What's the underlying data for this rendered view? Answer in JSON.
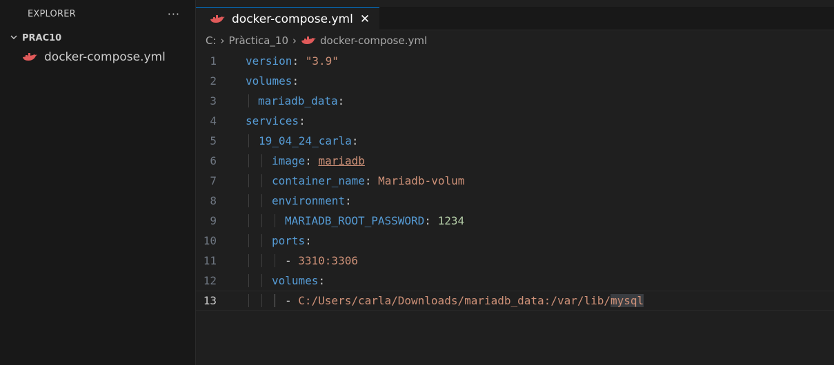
{
  "sidebar": {
    "title": "EXPLORER",
    "more": "···",
    "folder": "PRAC10",
    "files": [
      "docker-compose.yml"
    ]
  },
  "tab": {
    "label": "docker-compose.yml",
    "close": "✕"
  },
  "breadcrumb": {
    "drive": "C:",
    "folder": "Pràctica_10",
    "file": "docker-compose.yml"
  },
  "colors": {
    "key": "#569cd6",
    "string": "#ce9178",
    "number": "#b5cea8",
    "accent": "#0078d4",
    "whale": "#e05a5a"
  },
  "code": {
    "numbers": [
      "1",
      "2",
      "3",
      "4",
      "5",
      "6",
      "7",
      "8",
      "9",
      "10",
      "11",
      "12",
      "13"
    ],
    "l1": {
      "key": "version",
      "sep": ": ",
      "val": "\"3.9\""
    },
    "l2": {
      "key": "volumes",
      "sep": ":"
    },
    "l3": {
      "key": "mariadb_data",
      "sep": ":"
    },
    "l4": {
      "key": "services",
      "sep": ":"
    },
    "l5": {
      "key": "19_04_24_carla",
      "sep": ":"
    },
    "l6": {
      "key": "image",
      "sep": ": ",
      "val": "mariadb"
    },
    "l7": {
      "key": "container_name",
      "sep": ": ",
      "val": "Mariadb-volum"
    },
    "l8": {
      "key": "environment",
      "sep": ":"
    },
    "l9": {
      "key": "MARIADB_ROOT_PASSWORD",
      "sep": ": ",
      "val": "1234"
    },
    "l10": {
      "key": "ports",
      "sep": ":"
    },
    "l11": {
      "dash": "- ",
      "val": "3310:3306"
    },
    "l12": {
      "key": "volumes",
      "sep": ":"
    },
    "l13": {
      "dash": "- ",
      "val": "C:/Users/carla/Downloads/mariadb_data:/var/lib/",
      "hl": "mysql"
    }
  }
}
